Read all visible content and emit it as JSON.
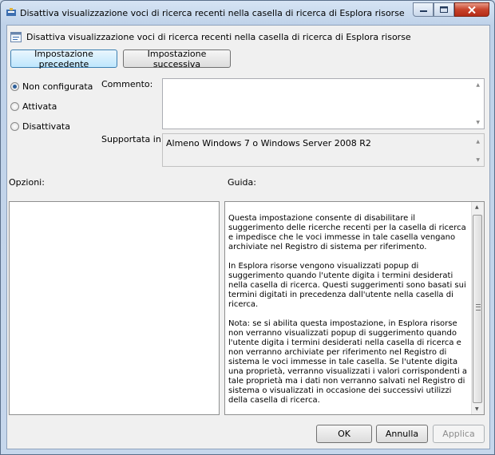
{
  "window": {
    "title": "Disattiva visualizzazione voci di ricerca recenti nella casella di ricerca di Esplora risorse"
  },
  "header": {
    "policy_name": "Disattiva visualizzazione voci di ricerca recenti nella casella di ricerca di Esplora risorse"
  },
  "nav": {
    "previous_label": "Impostazione precedente",
    "next_label": "Impostazione successiva"
  },
  "state": {
    "options": [
      "Non configurata",
      "Attivata",
      "Disattivata"
    ],
    "selected": "Non configurata"
  },
  "comment": {
    "label": "Commento:",
    "value": ""
  },
  "supported": {
    "label": "Supportata in:",
    "value": "Almeno Windows 7 o Windows Server 2008 R2"
  },
  "options_panel": {
    "label": "Opzioni:"
  },
  "help_panel": {
    "label": "Guida:",
    "paragraphs": [
      "Questa impostazione consente di disabilitare il suggerimento delle ricerche recenti per la casella di ricerca e impedisce che le voci immesse in tale casella vengano archiviate nel Registro di sistema per riferimento.",
      "In Esplora risorse vengono visualizzati popup di suggerimento quando l'utente digita i termini desiderati nella casella di ricerca. Questi suggerimenti sono basati sui termini digitati in precedenza dall'utente nella casella di ricerca.",
      "Nota: se si abilita questa impostazione, in Esplora risorse non verranno visualizzati popup di suggerimento quando l'utente digita i termini desiderati nella casella di ricerca e non verranno archiviate per riferimento nel Registro di sistema le voci immesse in tale casella. Se l'utente digita una proprietà, verranno visualizzati i valori corrispondenti a tale proprietà ma i dati non verranno salvati nel Registro di sistema o visualizzati in occasione dei successivi utilizzi della casella di ricerca."
    ]
  },
  "footer": {
    "ok_label": "OK",
    "cancel_label": "Annulla",
    "apply_label": "Applica"
  },
  "colors": {
    "close_button": "#c7432b",
    "selected_radio": "#2d5f9a"
  }
}
